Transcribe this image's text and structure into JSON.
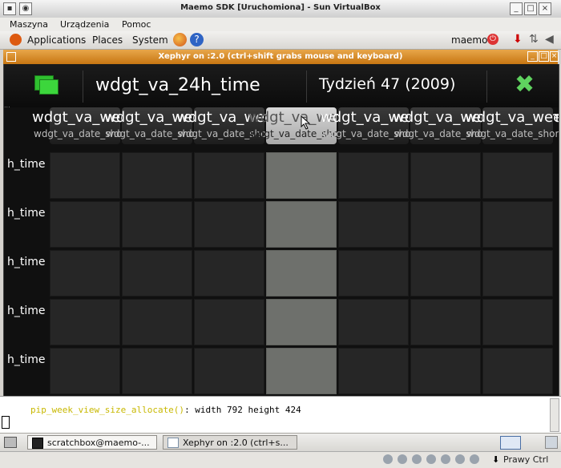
{
  "vbox": {
    "title": "Maemo SDK [Uruchomiona] - Sun VirtualBox",
    "menu": [
      "Maszyna",
      "Urządzenia",
      "Pomoc"
    ]
  },
  "gnome": {
    "applications": "Applications",
    "places": "Places",
    "system": "System",
    "user": "maemo"
  },
  "xephyr": {
    "title": "Xephyr on :2.0 (ctrl+shift grabs mouse and keyboard)"
  },
  "app": {
    "title": "wdgt_va_24h_time",
    "week": "Tydzień 47 (2009)",
    "ghost": "...",
    "days": [
      {
        "name": "wdgt_va_weekday_name_s",
        "date": "wdgt_va_date_short"
      },
      {
        "name": "wdgt_va_weekday_name_s",
        "date": "wdgt_va_date_short"
      },
      {
        "name": "wdgt_va_weekday_name_s",
        "date": "wdgt_va_date_short"
      },
      {
        "name": "wdgt_va_weekday_name_s",
        "date": "wdgt_va_date_short"
      },
      {
        "name": "wdgt_va_weekday_name_s",
        "date": "wdgt_va_date_short"
      },
      {
        "name": "wdgt_va_weekday_name_s",
        "date": "wdgt_va_date_short"
      },
      {
        "name": "wdgt_va_weekday_name_s",
        "date": "wdgt_va_date_short"
      }
    ],
    "selected_day_index": 3,
    "time_labels": [
      "h_time",
      "h_time",
      "h_time",
      "h_time",
      "h_time"
    ]
  },
  "terminal": {
    "function": "pip_week_view_size_allocate()",
    "rest": ": width 792 height 424"
  },
  "taskbar": {
    "items": [
      "scratchbox@maemo-...",
      "Xephyr on :2.0 (ctrl+s..."
    ]
  },
  "status": {
    "host_key": "Prawy Ctrl"
  },
  "colors": {
    "xephyr_title": "#c77612",
    "selected_column": "#6e706c",
    "cell": "#262626",
    "accent_green": "#2fbf2f"
  }
}
